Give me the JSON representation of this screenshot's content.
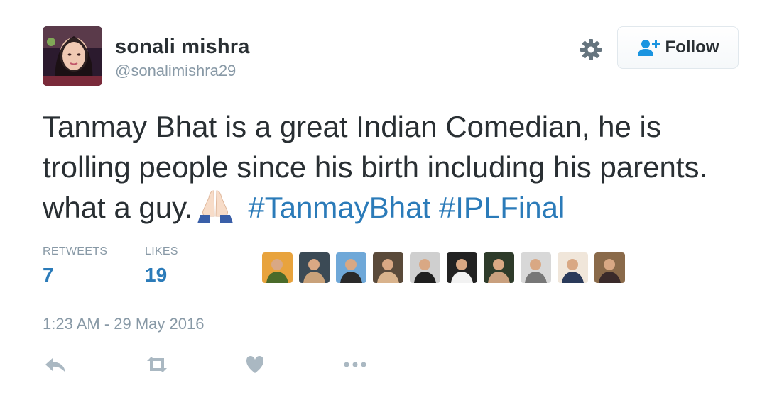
{
  "user": {
    "name": "sonali mishra",
    "handle": "@sonalimishra29"
  },
  "follow_button": {
    "label": "Follow",
    "icon": "follow-user-plus-icon"
  },
  "settings": {
    "icon": "gear-icon"
  },
  "tweet": {
    "text_line": "Tanmay Bhat is a great Indian Comedian, he is trolling people since his birth including his parents. what a guy.",
    "emoji": "folded-hands-emoji",
    "hashtags": [
      "#TanmayBhat",
      "#IPLFinal"
    ]
  },
  "stats": {
    "retweets_label": "RETWEETS",
    "retweets_count": "7",
    "likes_label": "LIKES",
    "likes_count": "19"
  },
  "likers": [
    {
      "bg": "#e8a33d",
      "fg": "#4a6b2a"
    },
    {
      "bg": "#3b4a55",
      "fg": "#c9a27a"
    },
    {
      "bg": "#6fa8d8",
      "fg": "#2a2a2a"
    },
    {
      "bg": "#5a4a3a",
      "fg": "#d9b38c"
    },
    {
      "bg": "#cfcfcf",
      "fg": "#1e1e1e"
    },
    {
      "bg": "#222222",
      "fg": "#f2f2f2"
    },
    {
      "bg": "#2e3b2a",
      "fg": "#c9a07e"
    },
    {
      "bg": "#d8d8d8",
      "fg": "#777777"
    },
    {
      "bg": "#f0e6da",
      "fg": "#2a3a5a"
    },
    {
      "bg": "#8a6a4a",
      "fg": "#3a2a2a"
    }
  ],
  "timestamp": "1:23 AM - 29 May 2016",
  "actions": {
    "reply_icon": "reply-icon",
    "retweet_icon": "retweet-icon",
    "like_icon": "heart-icon",
    "more_icon": "more-dots-icon"
  },
  "colors": {
    "accent": "#2b7bb9",
    "muted": "#8899a6",
    "text": "#292f33",
    "border": "#e1e8ed"
  }
}
